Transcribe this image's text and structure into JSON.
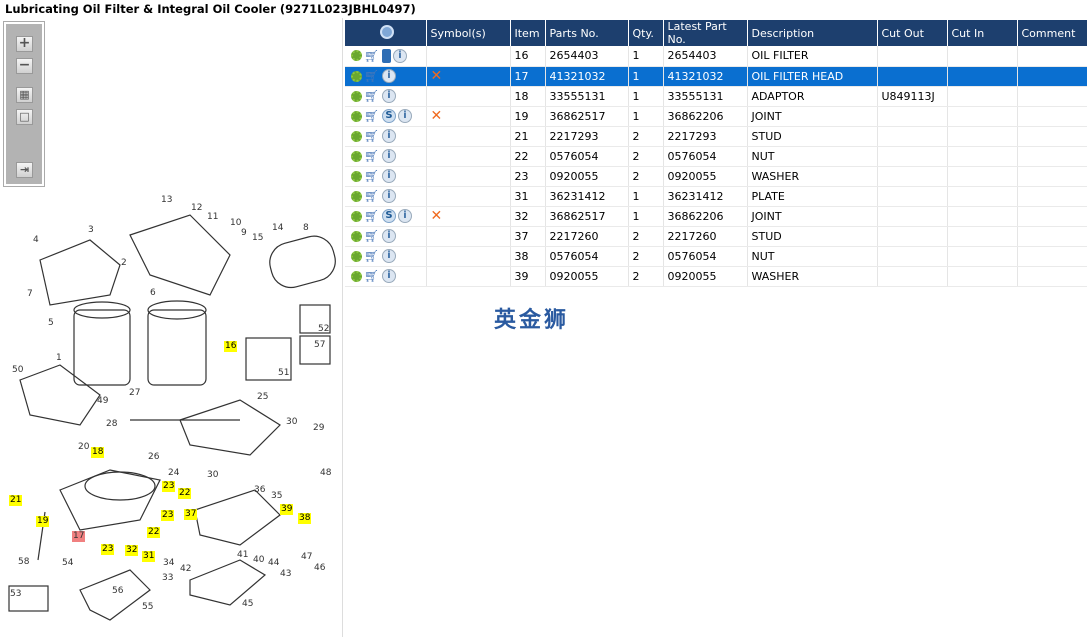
{
  "title": "Lubricating Oil Filter & Integral Oil Cooler (9271L023JBHL0497)",
  "toolbar": {
    "zoom_in": "+",
    "zoom_out": "−",
    "fit": "▦",
    "actual": "□",
    "panel": "⇥"
  },
  "diagram": {
    "callouts": [
      "13",
      "12",
      "11",
      "10",
      "9",
      "15",
      "14",
      "8",
      "3",
      "4",
      "2",
      "7",
      "6",
      "5",
      "1",
      "16",
      "52",
      "57",
      "51",
      "50",
      "49",
      "27",
      "28",
      "25",
      "30",
      "29",
      "26",
      "20",
      "18",
      "24",
      "30",
      "48",
      "21",
      "19",
      "23",
      "22",
      "23",
      "37",
      "36",
      "35",
      "39",
      "38",
      "17",
      "22",
      "23",
      "32",
      "31",
      "54",
      "58",
      "34",
      "33",
      "41",
      "40",
      "44",
      "43",
      "47",
      "46",
      "53",
      "56",
      "55",
      "45",
      "42"
    ]
  },
  "grid": {
    "columns": [
      "",
      "Symbol(s)",
      "Item",
      "Parts No.",
      "Qty.",
      "Latest Part No.",
      "Description",
      "Cut Out",
      "Cut In",
      "Comment"
    ],
    "rows": [
      {
        "icons": [
          "gear",
          "cart",
          "book",
          "info"
        ],
        "symbol": "",
        "item": "16",
        "part": "2654403",
        "qty": "1",
        "latest": "2654403",
        "desc": "OIL FILTER",
        "cut_out": "",
        "cut_in": "",
        "comment": ""
      },
      {
        "icons": [
          "gear",
          "cart",
          "info"
        ],
        "symbol": "✕",
        "item": "17",
        "part": "41321032",
        "qty": "1",
        "latest": "41321032",
        "desc": "OIL FILTER HEAD",
        "cut_out": "",
        "cut_in": "",
        "comment": "",
        "selected": true
      },
      {
        "icons": [
          "gear",
          "cart",
          "info"
        ],
        "symbol": "",
        "item": "18",
        "part": "33555131",
        "qty": "1",
        "latest": "33555131",
        "desc": "ADAPTOR",
        "cut_out": "U849113J",
        "cut_in": "",
        "comment": ""
      },
      {
        "icons": [
          "gear",
          "cart",
          "S",
          "info"
        ],
        "symbol": "✕",
        "item": "19",
        "part": "36862517",
        "qty": "1",
        "latest": "36862206",
        "desc": "JOINT",
        "cut_out": "",
        "cut_in": "",
        "comment": ""
      },
      {
        "icons": [
          "gear",
          "cart",
          "info"
        ],
        "symbol": "",
        "item": "21",
        "part": "2217293",
        "qty": "2",
        "latest": "2217293",
        "desc": "STUD",
        "cut_out": "",
        "cut_in": "",
        "comment": ""
      },
      {
        "icons": [
          "gear",
          "cart",
          "info"
        ],
        "symbol": "",
        "item": "22",
        "part": "0576054",
        "qty": "2",
        "latest": "0576054",
        "desc": "NUT",
        "cut_out": "",
        "cut_in": "",
        "comment": ""
      },
      {
        "icons": [
          "gear",
          "cart",
          "info"
        ],
        "symbol": "",
        "item": "23",
        "part": "0920055",
        "qty": "2",
        "latest": "0920055",
        "desc": "WASHER",
        "cut_out": "",
        "cut_in": "",
        "comment": ""
      },
      {
        "icons": [
          "gear",
          "cart",
          "info"
        ],
        "symbol": "",
        "item": "31",
        "part": "36231412",
        "qty": "1",
        "latest": "36231412",
        "desc": "PLATE",
        "cut_out": "",
        "cut_in": "",
        "comment": ""
      },
      {
        "icons": [
          "gear",
          "cart",
          "S",
          "info"
        ],
        "symbol": "✕",
        "item": "32",
        "part": "36862517",
        "qty": "1",
        "latest": "36862206",
        "desc": "JOINT",
        "cut_out": "",
        "cut_in": "",
        "comment": ""
      },
      {
        "icons": [
          "gear",
          "cart",
          "info"
        ],
        "symbol": "",
        "item": "37",
        "part": "2217260",
        "qty": "2",
        "latest": "2217260",
        "desc": "STUD",
        "cut_out": "",
        "cut_in": "",
        "comment": ""
      },
      {
        "icons": [
          "gear",
          "cart",
          "info"
        ],
        "symbol": "",
        "item": "38",
        "part": "0576054",
        "qty": "2",
        "latest": "0576054",
        "desc": "NUT",
        "cut_out": "",
        "cut_in": "",
        "comment": ""
      },
      {
        "icons": [
          "gear",
          "cart",
          "info"
        ],
        "symbol": "",
        "item": "39",
        "part": "0920055",
        "qty": "2",
        "latest": "0920055",
        "desc": "WASHER",
        "cut_out": "",
        "cut_in": "",
        "comment": ""
      }
    ]
  },
  "watermark": "英金狮",
  "colors": {
    "header": "#1d3f6e",
    "selected": "#0a6fd0",
    "highlight": "#ffff00",
    "current": "#f08080"
  }
}
